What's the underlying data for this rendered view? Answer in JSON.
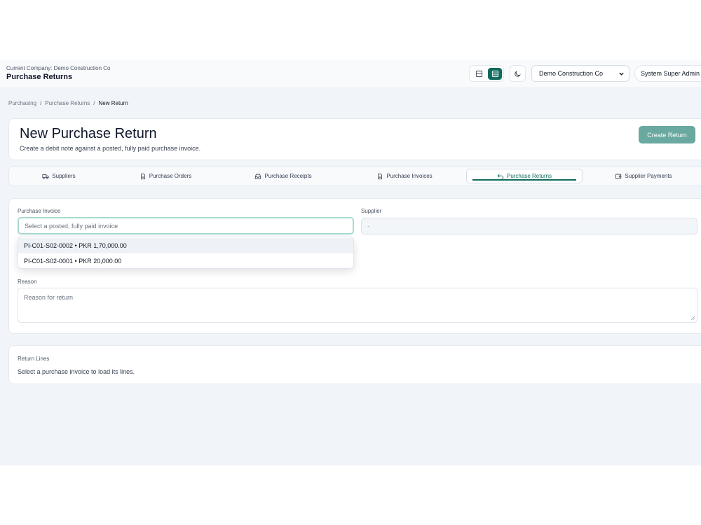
{
  "header": {
    "company_line": "Current Company: Demo Construction Co",
    "page_title": "Purchase Returns",
    "company_select": "Demo Construction Co",
    "user": "System Super Admin"
  },
  "breadcrumb": {
    "items": [
      "Purchasing",
      "Purchase Returns",
      "New Return"
    ],
    "separator": "/"
  },
  "page": {
    "title": "New Purchase Return",
    "subtitle": "Create a debit note against a posted, fully paid purchase invoice.",
    "create_button": "Create Return"
  },
  "tabs": [
    {
      "label": "Suppliers",
      "icon": "truck-icon"
    },
    {
      "label": "Purchase Orders",
      "icon": "document-icon"
    },
    {
      "label": "Purchase Receipts",
      "icon": "inbox-icon"
    },
    {
      "label": "Purchase Invoices",
      "icon": "document-icon"
    },
    {
      "label": "Purchase Returns",
      "icon": "return-arrow-icon",
      "active": true
    },
    {
      "label": "Supplier Payments",
      "icon": "wallet-icon"
    }
  ],
  "form": {
    "invoice_label": "Purchase Invoice",
    "invoice_placeholder": "Select a posted, fully paid invoice",
    "supplier_label": "Supplier",
    "supplier_value": "-",
    "reason_label": "Reason",
    "reason_placeholder": "Reason for return",
    "dropdown_options": [
      "PI-C01-S02-0002 • PKR 1,70,000.00",
      "PI-C01-S02-0001 • PKR 20,000.00"
    ]
  },
  "lines": {
    "title": "Return Lines",
    "message": "Select a purchase invoice to load its lines."
  },
  "colors": {
    "accent": "#0f6b5c",
    "button": "#6aa99f",
    "focus_ring": "#a8d9cf"
  }
}
